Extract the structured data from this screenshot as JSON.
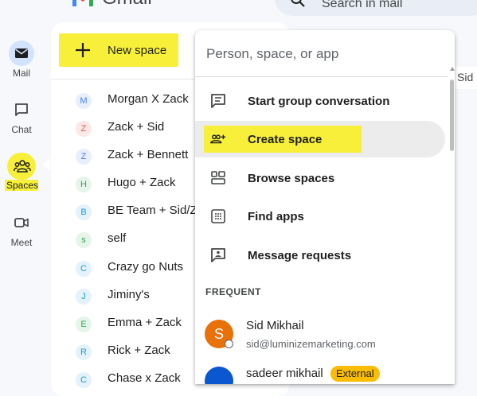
{
  "app": {
    "brand": "Gmail"
  },
  "search": {
    "placeholder": "Search in mail"
  },
  "rail": [
    {
      "label": "Mail",
      "icon": "mail-icon"
    },
    {
      "label": "Chat",
      "icon": "chat-icon"
    },
    {
      "label": "Spaces",
      "icon": "spaces-icon"
    },
    {
      "label": "Meet",
      "icon": "meet-icon"
    }
  ],
  "nav": {
    "new_space_label": "New space",
    "spaces": [
      {
        "initial": "M",
        "name": "Morgan X Zack",
        "color": "#4285f4",
        "bg": "#e8eefc"
      },
      {
        "initial": "Z",
        "name": "Zack + Sid",
        "color": "#e06055",
        "bg": "#fce8e6"
      },
      {
        "initial": "Z",
        "name": "Zack + Bennett",
        "color": "#5c7bd8",
        "bg": "#e8eefc"
      },
      {
        "initial": "H",
        "name": "Hugo + Zack",
        "color": "#34a853",
        "bg": "#e6f4ea"
      },
      {
        "initial": "B",
        "name": "BE Team + Sid/Z",
        "color": "#1a9fd0",
        "bg": "#e3f2fb"
      },
      {
        "initial": "s",
        "name": "self",
        "color": "#34a853",
        "bg": "#e6f4ea"
      },
      {
        "initial": "C",
        "name": "Crazy go Nuts",
        "color": "#1a9fd0",
        "bg": "#e3f2fb"
      },
      {
        "initial": "J",
        "name": "Jiminy's",
        "color": "#1a9fd0",
        "bg": "#e3f2fb"
      },
      {
        "initial": "E",
        "name": "Emma + Zack",
        "color": "#34a853",
        "bg": "#e6f4ea"
      },
      {
        "initial": "R",
        "name": "Rick + Zack",
        "color": "#1a9fd0",
        "bg": "#e3f2fb"
      },
      {
        "initial": "C",
        "name": "Chase x Zack",
        "color": "#1a9fd0",
        "bg": "#e3f2fb"
      }
    ]
  },
  "behind_header": {
    "text": "Sid"
  },
  "dropdown": {
    "input_placeholder": "Person, space, or app",
    "items": [
      {
        "label": "Start group conversation",
        "icon": "group-conversation-icon"
      },
      {
        "label": "Create space",
        "icon": "create-space-icon"
      },
      {
        "label": "Browse spaces",
        "icon": "browse-spaces-icon"
      },
      {
        "label": "Find apps",
        "icon": "apps-grid-icon"
      },
      {
        "label": "Message requests",
        "icon": "message-requests-icon"
      }
    ],
    "frequent_heading": "FREQUENT",
    "contacts": [
      {
        "initial": "S",
        "name": "Sid Mikhail",
        "email": "sid@luminizemarketing.com"
      },
      {
        "name": "sadeer mikhail",
        "badge": "External"
      }
    ]
  },
  "colors": {
    "highlight": "#f7ef3a",
    "active_rail": "#d3e3fd",
    "external_badge": "#fbbc04"
  }
}
